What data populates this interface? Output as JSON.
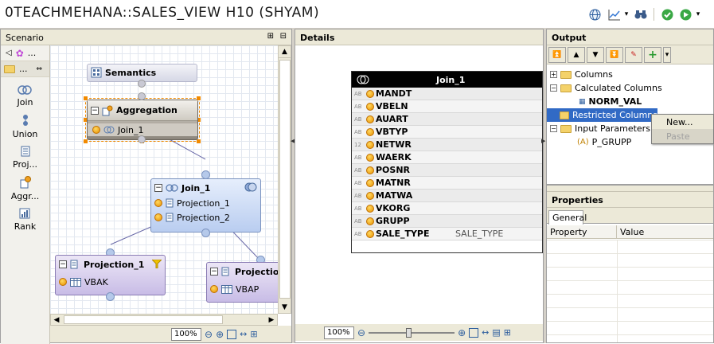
{
  "title": "0TEACHMEHANA::SALES_VIEW H10 (SHYAM)",
  "scenario": {
    "header": "Scenario",
    "palette_overflow": "...",
    "palette": [
      {
        "label": "Join",
        "icon": "join-icon"
      },
      {
        "label": "Union",
        "icon": "union-icon"
      },
      {
        "label": "Proj...",
        "icon": "projection-icon"
      },
      {
        "label": "Aggr...",
        "icon": "aggregation-icon"
      },
      {
        "label": "Rank",
        "icon": "rank-icon"
      }
    ],
    "zoom": "100%",
    "nodes": {
      "semantics": {
        "title": "Semantics"
      },
      "aggregation": {
        "title": "Aggregation",
        "items": [
          "Join_1"
        ]
      },
      "join": {
        "title": "Join_1",
        "items": [
          "Projection_1",
          "Projection_2"
        ]
      },
      "projection1": {
        "title": "Projection_1",
        "items": [
          "VBAK"
        ]
      },
      "projection2": {
        "title": "Projectio",
        "items": [
          "VBAP"
        ]
      }
    }
  },
  "details": {
    "header": "Details",
    "zoom": "100%",
    "table": {
      "title": "Join_1",
      "rows": [
        {
          "type": "AB",
          "name": "MANDT",
          "alias": ""
        },
        {
          "type": "AB",
          "name": "VBELN",
          "alias": ""
        },
        {
          "type": "AB",
          "name": "AUART",
          "alias": ""
        },
        {
          "type": "AB",
          "name": "VBTYP",
          "alias": ""
        },
        {
          "type": "12",
          "name": "NETWR",
          "alias": ""
        },
        {
          "type": "AB",
          "name": "WAERK",
          "alias": ""
        },
        {
          "type": "AB",
          "name": "POSNR",
          "alias": ""
        },
        {
          "type": "AB",
          "name": "MATNR",
          "alias": ""
        },
        {
          "type": "AB",
          "name": "MATWA",
          "alias": ""
        },
        {
          "type": "AB",
          "name": "VKORG",
          "alias": ""
        },
        {
          "type": "AB",
          "name": "GRUPP",
          "alias": ""
        },
        {
          "type": "AB",
          "name": "SALE_TYPE",
          "alias": "SALE_TYPE"
        }
      ]
    }
  },
  "output": {
    "header": "Output",
    "tree": {
      "columns": "Columns",
      "calculated": "Calculated Columns",
      "norm_val": "NORM_VAL",
      "restricted": "Restricted Columns",
      "input_params": "Input Parameters",
      "p_grupp": "P_GRUPP"
    },
    "context_menu": {
      "new": "New...",
      "paste": "Paste"
    }
  },
  "properties": {
    "header": "Properties",
    "tab": "General",
    "col_property": "Property",
    "col_value": "Value"
  }
}
